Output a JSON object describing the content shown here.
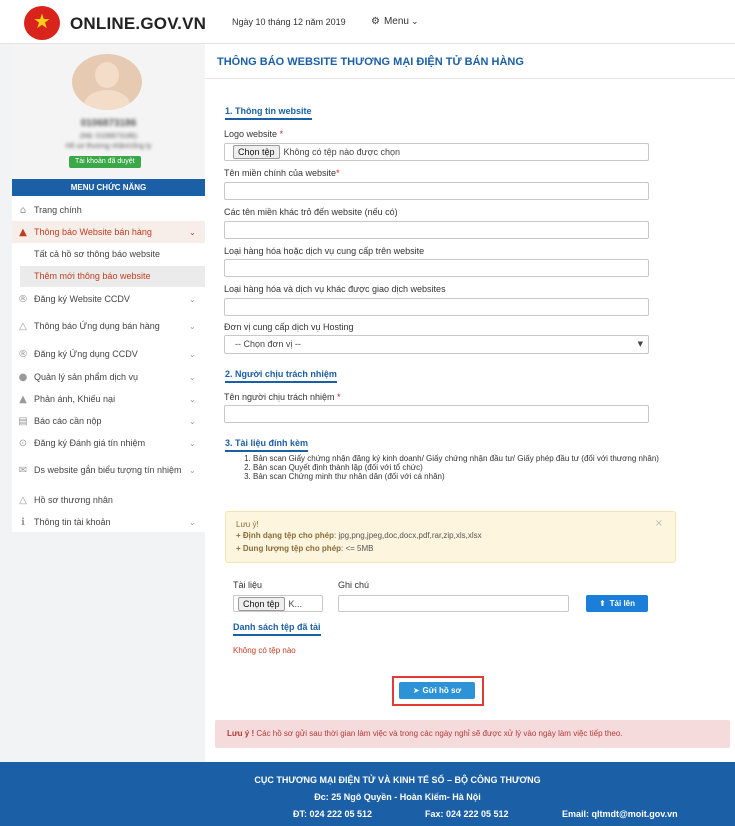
{
  "header": {
    "site_name": "ONLINE.GOV.VN",
    "date": "Ngày 10 tháng 12 năm 2019",
    "menu_label": "Menu"
  },
  "sidebar": {
    "user_tax_code": "0106873186",
    "user_line2": "(Mã: 0106873186)",
    "user_line3": "Hồ sơ thương nhân/công ty",
    "verified_badge": "Tài khoản đã duyệt",
    "menu_title": "MENU CHỨC NĂNG",
    "items": [
      {
        "label": "Trang chính",
        "icon": "home-icon"
      },
      {
        "label": "Thông báo Website bán hàng",
        "icon": "bell-icon"
      },
      {
        "label": "Tất cả hồ sơ thông báo website"
      },
      {
        "label": "Thêm mới thông báo website"
      },
      {
        "label": "Đăng ký Website CCDV",
        "icon": "registered-icon"
      },
      {
        "label": "Thông báo Ứng dụng bán hàng",
        "icon": "bell-outline-icon"
      },
      {
        "label": "Đăng ký Ứng dụng CCDV",
        "icon": "registered-icon"
      },
      {
        "label": "Quản lý sản phẩm dịch vụ",
        "icon": "product-icon"
      },
      {
        "label": "Phản ánh, Khiếu nại",
        "icon": "warning-icon"
      },
      {
        "label": "Báo cáo cần nộp",
        "icon": "document-icon"
      },
      {
        "label": "Đăng ký Đánh giá tín nhiệm",
        "icon": "check-circle-icon"
      },
      {
        "label": "Ds website gắn biểu tượng tín nhiệm",
        "icon": "email-icon"
      },
      {
        "label": "Hồ sơ thương nhân",
        "icon": "bell-outline-icon"
      },
      {
        "label": "Thông tin tài khoản",
        "icon": "info-icon"
      }
    ]
  },
  "main": {
    "title": "THÔNG BÁO WEBSITE THƯƠNG MẠI ĐIỆN TỬ BÁN HÀNG",
    "section1": "1. Thông tin website",
    "logo_label": "Logo website",
    "required_mark": "*",
    "file_button": "Chọn tệp",
    "file_status": "Không có tệp nào được chọn",
    "domain_label": "Tên miền chính của website",
    "other_domains_label": "Các tên miền khác trỏ đến website (nếu có)",
    "goods_label": "Loại hàng hóa hoặc dịch vụ cung cấp trên website",
    "goods_other_label": "Loại hàng hóa và dịch vụ khác được giao dịch websites",
    "hosting_label": "Đơn vị cung cấp dịch vụ Hosting",
    "hosting_select": "-- Chọn đơn vị --",
    "section2": "2. Người chịu trách nhiệm",
    "person_label": "Tên người chịu trách nhiệm",
    "section3": "3. Tài liệu đính kèm",
    "documents": [
      "Bản scan Giấy chứng nhận đăng ký kinh doanh/ Giấy chứng nhận đầu tư/ Giấy phép đầu tư (đối với thương nhân)",
      "Bản scan Quyết định thành lập (đối với tổ chức)",
      "Bản scan Chứng minh thư nhân dân (đối với cá nhân)"
    ],
    "notice_title": "Lưu ý!",
    "notice_format_label": "+ Định dạng tệp cho phép",
    "notice_format_value": ": jpg,png,jpeg,doc,docx,pdf,rar,zip,xls,xlsx",
    "notice_size_label": "+ Dung lượng tệp cho phép",
    "notice_size_value": ": <= 5MB",
    "notice_close": "×",
    "doc_label": "Tài liệu",
    "note_label": "Ghi chú",
    "file_button_short": "Chọn tệp",
    "file_status_short": "K...",
    "upload_button": "Tải lên",
    "uploaded_list": "Danh sách tệp đã tải",
    "no_file": "Không có tệp nào",
    "submit_button": "Gửi hồ sơ",
    "warning_bold": "Lưu ý !",
    "warning_text": " Các hồ sơ gửi sau thời gian làm việc và trong các ngày nghỉ sẽ được xử lý vào ngày làm việc tiếp theo."
  },
  "footer": {
    "org": "CỤC THƯƠNG MẠI ĐIỆN TỬ VÀ KINH TẾ SỐ – BỘ CÔNG THƯƠNG",
    "address": "Đc: 25 Ngô Quyền - Hoàn Kiếm- Hà Nội",
    "phone": "ĐT: 024 222 05 512",
    "fax": "Fax: 024 222 05 512",
    "email": "Email: qltmdt@moit.gov.vn"
  },
  "colors": {
    "brand_blue": "#1b5fa6",
    "active_red": "#c23d1f",
    "upload_blue": "#1b7ed8",
    "verified_green": "#3aa848"
  }
}
